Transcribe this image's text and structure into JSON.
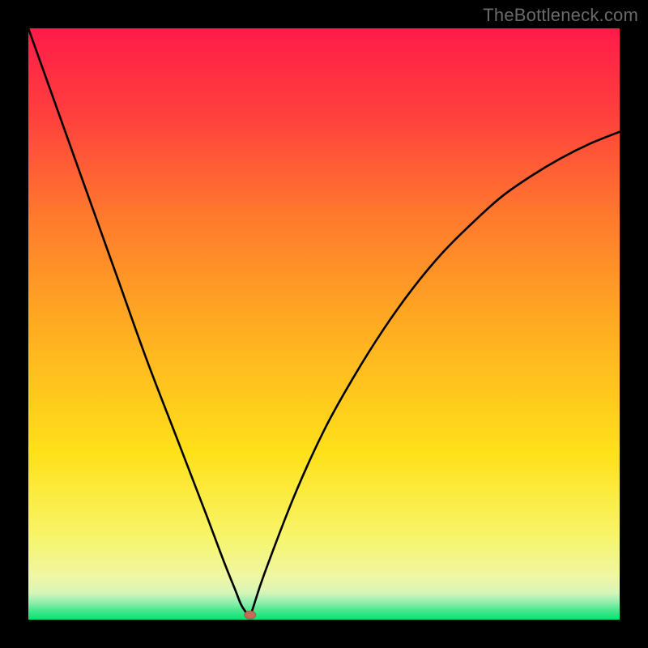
{
  "watermark": "TheBottleneck.com",
  "chart_data": {
    "type": "line",
    "title": "",
    "xlabel": "",
    "ylabel": "",
    "xlim": [
      0,
      100
    ],
    "ylim": [
      0,
      100
    ],
    "grid": false,
    "legend": false,
    "background_gradient": {
      "top_color": "#ff1b49",
      "mid_color": "#ffe400",
      "bottom_band_color": "#00e86b",
      "bottom_band_fraction": 0.05
    },
    "series": [
      {
        "name": "bottleneck-curve",
        "color": "#000000",
        "x": [
          0,
          5,
          10,
          15,
          20,
          25,
          30,
          33,
          35,
          36,
          37,
          37.5,
          38,
          40,
          45,
          50,
          55,
          60,
          65,
          70,
          75,
          80,
          85,
          90,
          95,
          100
        ],
        "values": [
          100,
          86,
          72,
          58,
          44,
          31,
          18,
          10,
          5,
          2.5,
          1,
          0.5,
          2,
          8,
          21,
          32,
          41,
          49,
          56,
          62,
          67,
          71.5,
          75,
          78,
          80.5,
          82.5
        ]
      }
    ],
    "marker": {
      "name": "optimal-point",
      "x": 37.5,
      "y": 0.8,
      "color": "#c66a57",
      "rx": 7,
      "ry": 5
    }
  }
}
